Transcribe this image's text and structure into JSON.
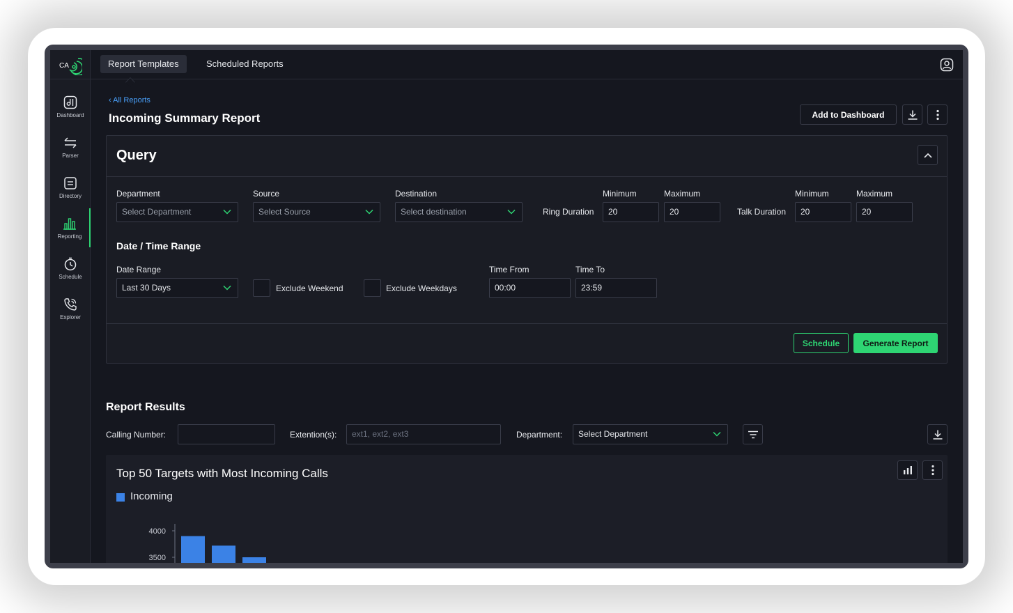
{
  "logo": {
    "text": "CA"
  },
  "sidebar": {
    "items": [
      {
        "label": "Dashboard"
      },
      {
        "label": "Parser"
      },
      {
        "label": "Directory"
      },
      {
        "label": "Reporting"
      },
      {
        "label": "Schedule"
      },
      {
        "label": "Explorer"
      }
    ],
    "active": "Reporting"
  },
  "topbar": {
    "tabs": [
      {
        "label": "Report Templates"
      },
      {
        "label": "Scheduled Reports"
      }
    ],
    "active_tab": "Report Templates"
  },
  "header": {
    "breadcrumb": "All Reports",
    "title": "Incoming Summary Report",
    "add_to_dashboard": "Add to Dashboard"
  },
  "query": {
    "title": "Query",
    "department": {
      "label": "Department",
      "placeholder": "Select Department"
    },
    "source": {
      "label": "Source",
      "placeholder": "Select Source"
    },
    "destination": {
      "label": "Destination",
      "placeholder": "Select destination"
    },
    "ring_duration": {
      "label": "Ring Duration",
      "min_label": "Minimum",
      "max_label": "Maximum",
      "min": "20",
      "max": "20"
    },
    "talk_duration": {
      "label": "Talk Duration",
      "min_label": "Minimum",
      "max_label": "Maximum",
      "min": "20",
      "max": "20"
    },
    "date_time_title": "Date / Time Range",
    "date_range": {
      "label": "Date Range",
      "value": "Last 30 Days"
    },
    "exclude_weekend": "Exclude Weekend",
    "exclude_weekdays": "Exclude Weekdays",
    "time_from": {
      "label": "Time From",
      "value": "00:00"
    },
    "time_to": {
      "label": "Time To",
      "value": "23:59"
    },
    "schedule_button": "Schedule",
    "generate_button": "Generate Report"
  },
  "results": {
    "title": "Report Results",
    "calling_number_label": "Calling Number:",
    "calling_number_value": "",
    "extensions_label": "Extention(s):",
    "extensions_placeholder": "ext1, ext2, ext3",
    "department_label": "Department:",
    "department_value": "Select Department"
  },
  "colors": {
    "accent": "#2ed573",
    "link": "#4aa3ff",
    "bar": "#3b82e6"
  },
  "chart_data": {
    "type": "bar",
    "title": "Top 50 Targets with Most Incoming Calls",
    "series": [
      {
        "name": "Incoming",
        "values": [
          3900,
          3720,
          3500
        ]
      }
    ],
    "y_ticks": [
      "4000",
      "3500"
    ],
    "ylim": [
      3500,
      4000
    ],
    "legend": "top-left"
  }
}
